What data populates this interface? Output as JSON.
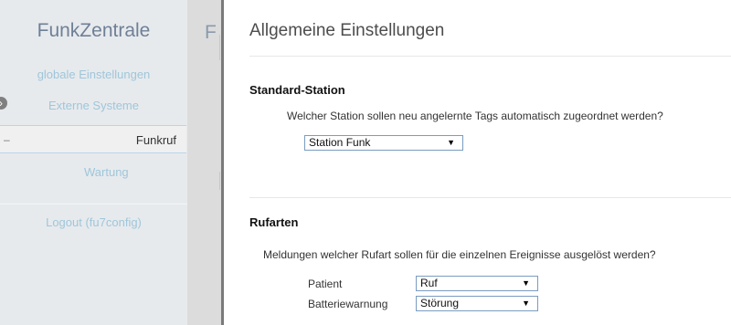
{
  "sidebar": {
    "title": "FunkZentrale",
    "items": [
      {
        "label": "globale Einstellungen"
      },
      {
        "label": "Externe Systeme"
      },
      {
        "label": "Funkruf"
      },
      {
        "label": "Wartung"
      },
      {
        "label": "Logout (fu7config)"
      }
    ],
    "bullet_glyph": "›",
    "active_dash": "–"
  },
  "strip": {
    "peek_letter": "F"
  },
  "main": {
    "title": "Allgemeine Einstellungen",
    "standard_station": {
      "heading": "Standard-Station",
      "description": "Welcher Station sollen neu angelernte Tags automatisch zugeordnet werden?",
      "selected": "Station Funk"
    },
    "rufarten": {
      "heading": "Rufarten",
      "description": "Meldungen welcher Rufart sollen für die einzelnen Ereignisse ausgelöst werden?",
      "rows": [
        {
          "label": "Patient",
          "selected": "Ruf"
        },
        {
          "label": "Batteriewarnung",
          "selected": "Störung"
        }
      ]
    }
  },
  "colors": {
    "sidebar_bg": "#e7eaed",
    "sidebar_link": "#9fc6da",
    "title": "#6f8096"
  }
}
